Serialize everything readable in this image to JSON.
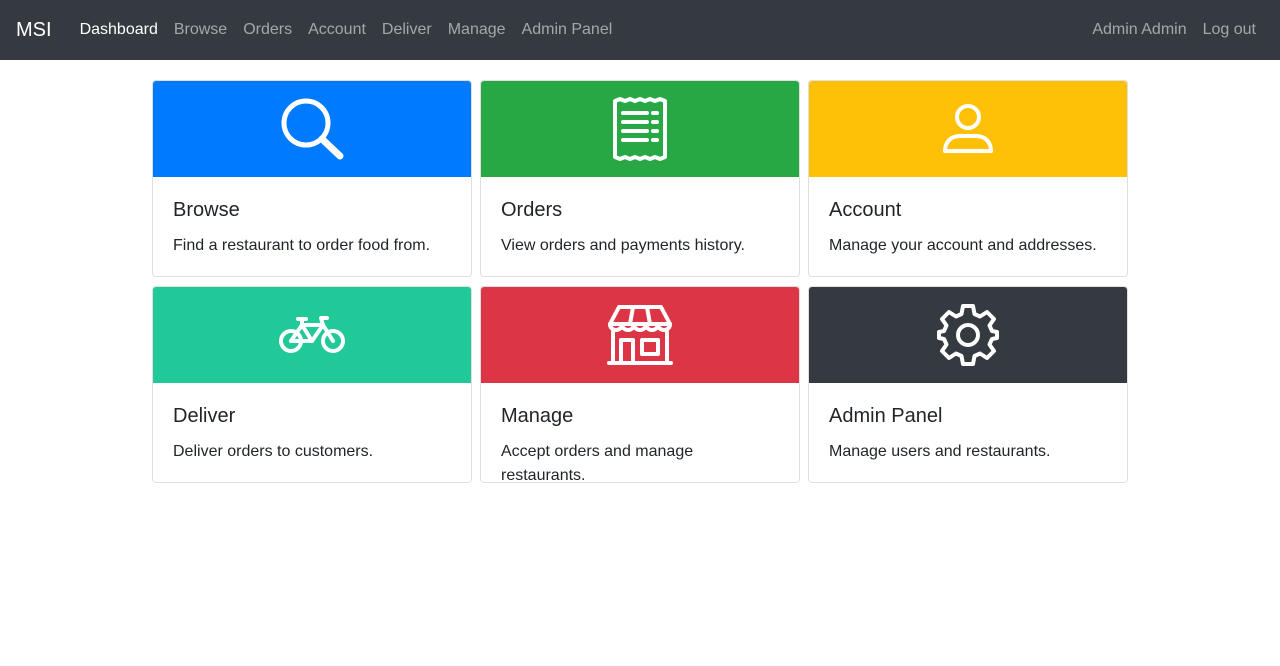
{
  "navbar": {
    "brand": "MSI",
    "links": [
      {
        "label": "Dashboard",
        "active": true
      },
      {
        "label": "Browse"
      },
      {
        "label": "Orders"
      },
      {
        "label": "Account"
      },
      {
        "label": "Deliver"
      },
      {
        "label": "Manage"
      },
      {
        "label": "Admin Panel"
      }
    ],
    "user_name": "Admin Admin",
    "logout_label": "Log out"
  },
  "cards": [
    {
      "title": "Browse",
      "text": "Find a restaurant to order food from.",
      "color": "#007bff",
      "icon": "search-icon"
    },
    {
      "title": "Orders",
      "text": "View orders and payments history.",
      "color": "#28a745",
      "icon": "receipt-icon"
    },
    {
      "title": "Account",
      "text": "Manage your account and addresses.",
      "color": "#ffc107",
      "icon": "user-icon"
    },
    {
      "title": "Deliver",
      "text": "Deliver orders to customers.",
      "color": "#20c997",
      "icon": "bicycle-icon"
    },
    {
      "title": "Manage",
      "text": "Accept orders and manage restaurants.",
      "color": "#dc3545",
      "icon": "store-icon"
    },
    {
      "title": "Admin Panel",
      "text": "Manage users and restaurants.",
      "color": "#343a40",
      "icon": "gear-icon"
    }
  ]
}
